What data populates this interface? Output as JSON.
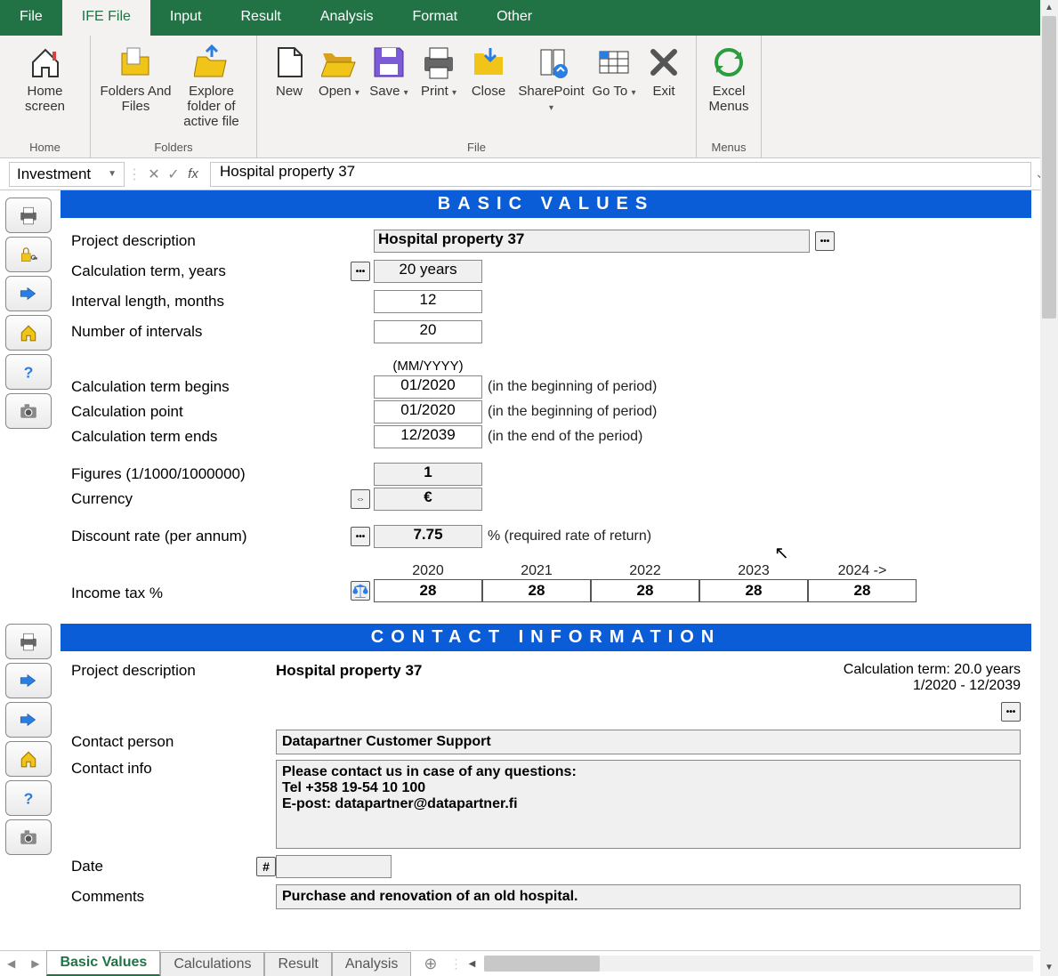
{
  "menubar": {
    "tabs": [
      "File",
      "IFE File",
      "Input",
      "Result",
      "Analysis",
      "Format",
      "Other"
    ],
    "active": 1
  },
  "ribbon": {
    "groups": [
      {
        "label": "Home",
        "items": [
          {
            "name": "home-screen-btn",
            "label": "Home screen",
            "icon": "home"
          }
        ]
      },
      {
        "label": "Folders",
        "items": [
          {
            "name": "folders-and-files-btn",
            "label": "Folders And Files",
            "icon": "folders"
          },
          {
            "name": "explore-folder-btn",
            "label": "Explore folder of active file",
            "icon": "explore"
          }
        ]
      },
      {
        "label": "File",
        "items": [
          {
            "name": "new-btn",
            "label": "New",
            "icon": "file",
            "narrow": true
          },
          {
            "name": "open-btn",
            "label": "Open",
            "icon": "folder-open",
            "narrow": true,
            "dd": true
          },
          {
            "name": "save-btn",
            "label": "Save",
            "icon": "save",
            "narrow": true,
            "dd": true
          },
          {
            "name": "print-btn",
            "label": "Print",
            "icon": "print",
            "narrow": true,
            "dd": true
          },
          {
            "name": "close-btn",
            "label": "Close",
            "icon": "close",
            "narrow": true
          },
          {
            "name": "sharepoint-btn",
            "label": "SharePoint",
            "icon": "sharepoint",
            "dd": true
          },
          {
            "name": "goto-btn",
            "label": "Go To",
            "icon": "goto",
            "narrow": true,
            "dd": true
          },
          {
            "name": "exit-btn",
            "label": "Exit",
            "icon": "exit",
            "narrow": true
          }
        ]
      },
      {
        "label": "Menus",
        "items": [
          {
            "name": "excel-menus-btn",
            "label": "Excel Menus",
            "icon": "refresh",
            "narrow": true
          }
        ]
      }
    ]
  },
  "formula_bar": {
    "name_box": "Investment",
    "formula": "Hospital property 37"
  },
  "side1": [
    {
      "name": "print-side-btn",
      "icon": "print"
    },
    {
      "name": "lock-side-btn",
      "icon": "lock"
    },
    {
      "name": "pointer-side-btn",
      "icon": "pointer"
    },
    {
      "name": "home-side-btn",
      "icon": "home2"
    },
    {
      "name": "help-side-btn",
      "icon": "help"
    },
    {
      "name": "camera-side-btn",
      "icon": "camera"
    }
  ],
  "side2": [
    {
      "name": "print-side2-btn",
      "icon": "print"
    },
    {
      "name": "pointer-side2-btn",
      "icon": "pointer"
    },
    {
      "name": "pointer2-side2-btn",
      "icon": "pointer"
    },
    {
      "name": "home-side2-btn",
      "icon": "home2"
    },
    {
      "name": "help-side2-btn",
      "icon": "help"
    },
    {
      "name": "camera-side2-btn",
      "icon": "camera"
    }
  ],
  "basic": {
    "header": "BASIC VALUES",
    "project_desc_label": "Project description",
    "project_desc": "Hospital property 37",
    "calc_term_label": "Calculation term, years",
    "calc_term": "20 years",
    "interval_len_label": "Interval length, months",
    "interval_len": "12",
    "num_intervals_label": "Number of intervals",
    "num_intervals": "20",
    "mmyyyy": "(MM/YYYY)",
    "begins_label": "Calculation term begins",
    "begins": "01/2020",
    "begins_note": "(in the beginning of period)",
    "point_label": "Calculation point",
    "point": "01/2020",
    "point_note": "(in the beginning of period)",
    "ends_label": "Calculation term ends",
    "ends": "12/2039",
    "ends_note": "(in the end of the period)",
    "figures_label": "Figures (1/1000/1000000)",
    "figures": "1",
    "currency_label": "Currency",
    "currency": "€",
    "discount_label": "Discount rate (per annum)",
    "discount": "7.75",
    "discount_note": "%  (required rate of return)",
    "income_tax_label": "Income tax %",
    "tax_years": [
      "2020",
      "2021",
      "2022",
      "2023",
      "2024 ->"
    ],
    "tax_vals": [
      "28",
      "28",
      "28",
      "28",
      "28"
    ]
  },
  "contact": {
    "header": "CONTACT INFORMATION",
    "project_desc_label": "Project description",
    "project_desc": "Hospital property 37",
    "calc_term_line1": "Calculation term: 20.0 years",
    "calc_term_line2": "1/2020 -  12/2039",
    "contact_person_label": "Contact person",
    "contact_person": "Datapartner Customer Support",
    "contact_info_label": "Contact info",
    "contact_info_line1": "Please contact us in case of any questions:",
    "contact_info_line2": "Tel +358 19-54 10 100",
    "contact_info_line3": "E-post: datapartner@datapartner.fi",
    "date_label": "Date",
    "date_btn": "#",
    "comments_label": "Comments",
    "comments": "Purchase and renovation of an old hospital."
  },
  "sheets": {
    "tabs": [
      "Basic Values",
      "Calculations",
      "Result",
      "Analysis"
    ],
    "active": 0
  }
}
